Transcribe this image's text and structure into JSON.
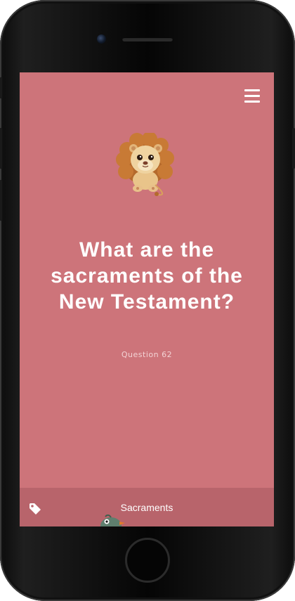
{
  "screen": {
    "background_color": "#cd747a",
    "menu": {
      "icon": "hamburger-menu-icon"
    },
    "mascot": {
      "icon": "lion-mascot-icon"
    },
    "question": {
      "title": "What are the sacraments of the New Testament?",
      "number_label": "Question 62"
    },
    "tag_bar": {
      "icon": "tag-icon",
      "label": "Sacraments",
      "mascot_icon": "bird-mascot-icon"
    }
  },
  "device": {
    "frame_color": "#0b0b0b"
  }
}
